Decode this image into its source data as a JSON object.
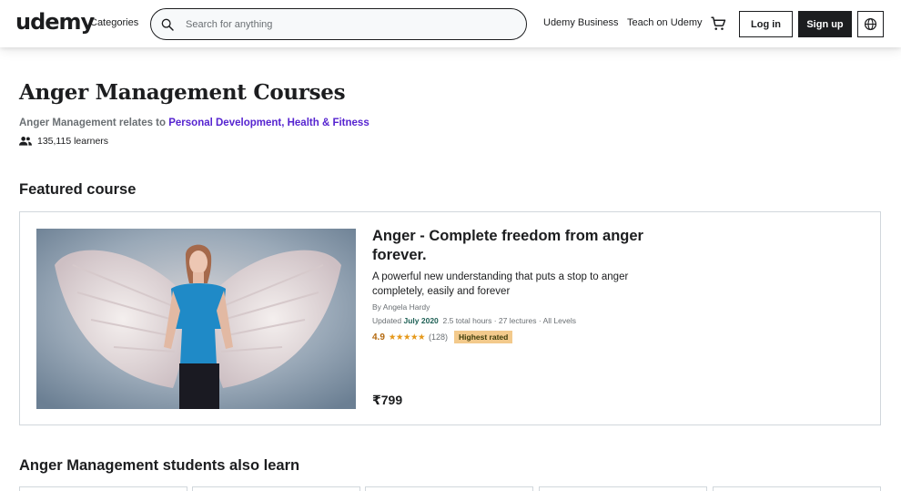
{
  "header": {
    "logo_text": "udemy",
    "categories_label": "Categories",
    "search_placeholder": "Search for anything",
    "udemy_business_label": "Udemy Business",
    "teach_label": "Teach on Udemy",
    "login_label": "Log in",
    "signup_label": "Sign up",
    "icons": [
      "search-icon",
      "cart-icon",
      "globe-icon"
    ]
  },
  "topic": {
    "title": "Anger Management Courses",
    "relates_prefix": "Anger Management relates to ",
    "related_links": [
      "Personal Development",
      "Health & Fitness"
    ],
    "link_separator": ", ",
    "learners_count": "135,115 learners"
  },
  "featured_section": {
    "heading": "Featured course",
    "course": {
      "title": "Anger - Complete freedom from anger forever.",
      "headline": "A powerful new understanding that puts a stop to anger completely, easily and forever",
      "author": "By Angela Hardy",
      "updated_prefix": "Updated ",
      "updated_date": "July 2020",
      "details": "2.5 total hours · 27 lectures · All Levels",
      "rating": "4.9",
      "stars": 5,
      "reviews": "(128)",
      "badge": "Highest rated",
      "price": "₹799"
    }
  },
  "also_learn": {
    "heading": "Anger Management students also learn"
  },
  "colors": {
    "brand_purple": "#a435f0",
    "link_purple": "#5624d0",
    "text_dark": "#1c1d1f",
    "rating_orange": "#b4690e",
    "badge_bg": "#f3ca8c",
    "updated_green": "#1e6055"
  }
}
